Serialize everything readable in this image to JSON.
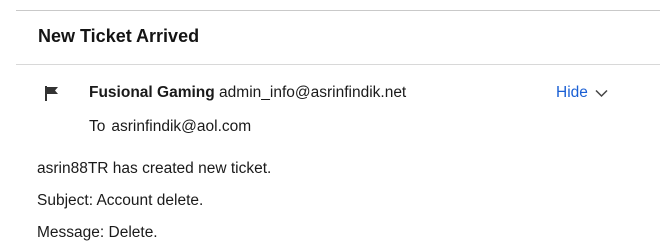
{
  "header": {
    "title": "New Ticket Arrived"
  },
  "sender": {
    "flag_icon": "flag-icon",
    "name": "Fusional Gaming",
    "email": "admin_info@asrinfindik.net",
    "hide_label": "Hide",
    "chevron_icon": "chevron-down-icon",
    "accent_color": "#1a5fd4"
  },
  "recipient": {
    "to_label": "To",
    "email": "asrinfindik@aol.com"
  },
  "message": {
    "line1": "asrin88TR has created new ticket.",
    "line2": "Subject: Account delete.",
    "line3": "Message: Delete."
  }
}
